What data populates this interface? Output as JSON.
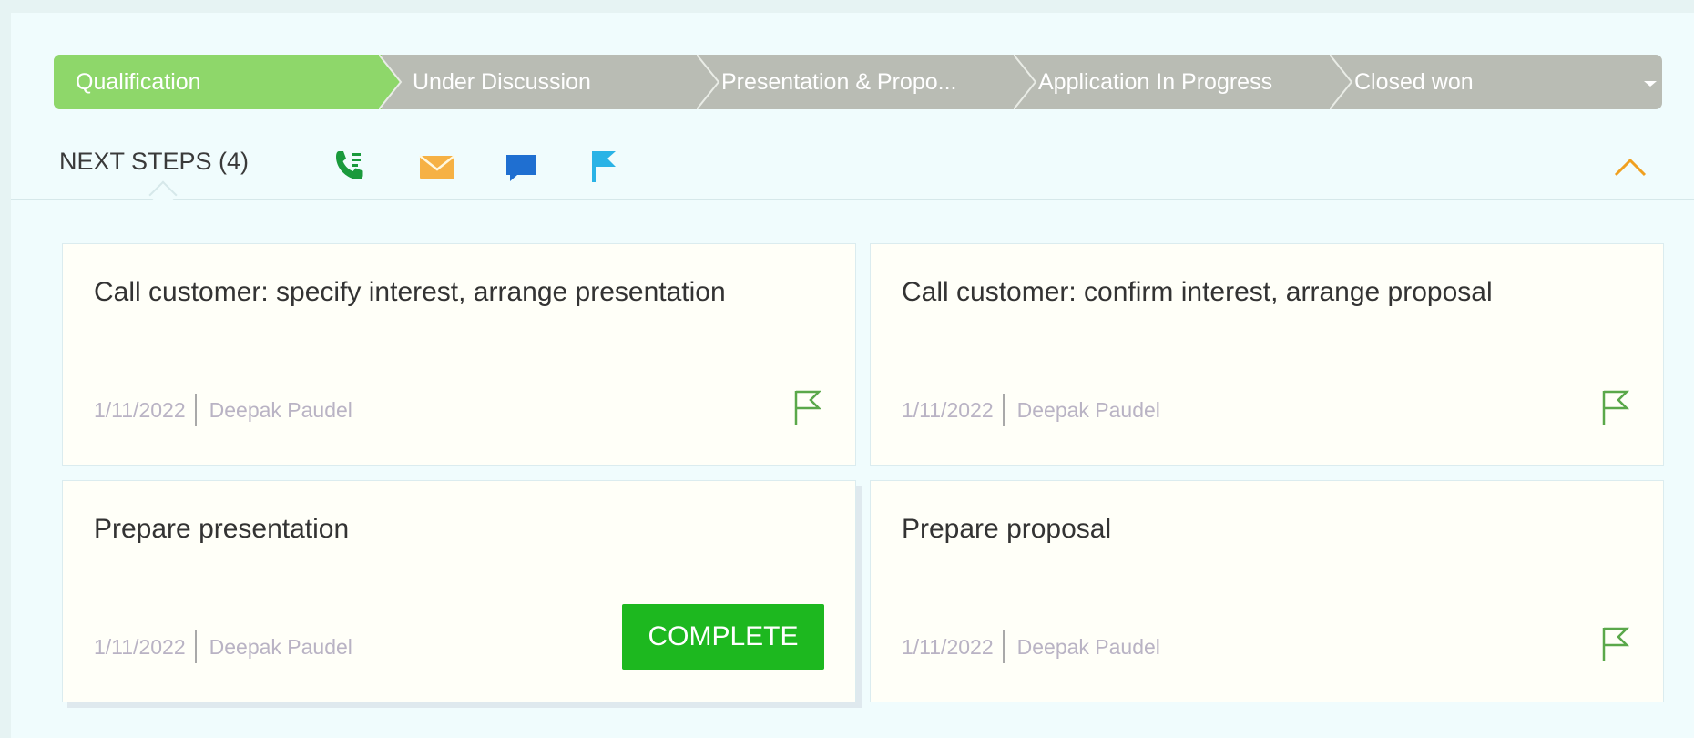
{
  "stages": {
    "items": [
      {
        "label": "Qualification",
        "active": true
      },
      {
        "label": "Under Discussion",
        "active": false
      },
      {
        "label": "Presentation & Propo...",
        "active": false
      },
      {
        "label": "Application In Progress",
        "active": false
      },
      {
        "label": "Closed won",
        "active": false
      }
    ]
  },
  "next_steps": {
    "tab_label": "NEXT STEPS (4)",
    "action_icons": [
      "phone-call-icon",
      "email-icon",
      "chat-icon",
      "flag-icon"
    ],
    "collapse_icon": "chevron-up-icon"
  },
  "cards": [
    {
      "title": "Call customer: specify interest, arrange presentation",
      "date": "1/11/2022",
      "owner": "Deepak Paudel",
      "action": "flag"
    },
    {
      "title": "Call customer: confirm interest, arrange proposal",
      "date": "1/11/2022",
      "owner": "Deepak Paudel",
      "action": "flag"
    },
    {
      "title": "Prepare presentation",
      "date": "1/11/2022",
      "owner": "Deepak Paudel",
      "action": "complete",
      "complete_label": "COMPLETE"
    },
    {
      "title": "Prepare proposal",
      "date": "1/11/2022",
      "owner": "Deepak Paudel",
      "action": "flag"
    }
  ],
  "colors": {
    "active_stage": "#8ed76a",
    "inactive_stage": "#b9bcb4",
    "complete_button": "#1db81f",
    "phone_icon": "#1a9a3c",
    "email_icon": "#f6b144",
    "chat_icon": "#1f6fd1",
    "flag_action_icon": "#2ab3e6",
    "card_flag_icon": "#5aa84a",
    "collapse_icon": "#f0a020"
  }
}
